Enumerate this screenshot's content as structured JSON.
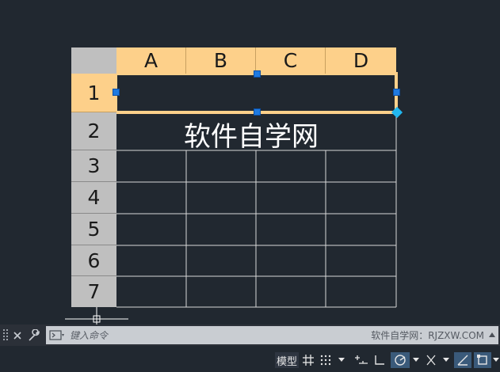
{
  "table": {
    "columns": [
      "A",
      "B",
      "C",
      "D"
    ],
    "rows": [
      "1",
      "2",
      "3",
      "4",
      "5",
      "6",
      "7"
    ],
    "cell_text": "软件自学网",
    "selected_row": "1"
  },
  "command_line": {
    "placeholder": "键入命令",
    "watermark": "软件自学网：RJZXW.COM"
  },
  "status_bar": {
    "model_label": "模型"
  },
  "colors": {
    "background": "#212830",
    "header_fill": "#fdd08a",
    "row_header_fill": "#bfbfbf",
    "grip": "#1f7ae0"
  }
}
